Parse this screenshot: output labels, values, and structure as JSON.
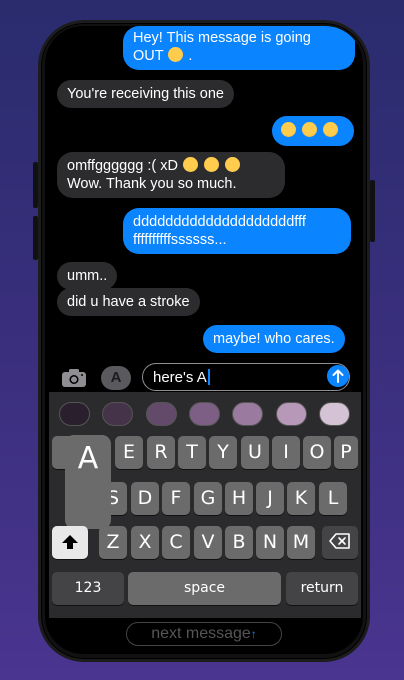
{
  "messages": [
    {
      "dir": "out",
      "text": "Hey! This message is going OUT",
      "suffix": "."
    },
    {
      "dir": "in",
      "text": "You're receiving this one"
    },
    {
      "dir": "out",
      "text": ""
    },
    {
      "dir": "in",
      "line1": "omffgggggg :( xD",
      "line2": "Wow. Thank you so much."
    },
    {
      "dir": "out",
      "line1": "ddddddddddddddddddddfff",
      "line2": "ffffffffffssssss..."
    },
    {
      "dir": "in",
      "text": "umm.."
    },
    {
      "dir": "in",
      "text": "did u have a stroke"
    },
    {
      "dir": "out",
      "text": "maybe! who cares."
    }
  ],
  "composer": {
    "value": "here's A",
    "camera_icon": "camera-icon",
    "apps_icon": "app-store-icon",
    "send_icon": "arrow-up-icon"
  },
  "swatches": [
    "#2a1f2d",
    "#45334a",
    "#634a6a",
    "#7d5f85",
    "#9a7a9f",
    "#b898b8",
    "#d4c3d4"
  ],
  "keyboard": {
    "popup": "A",
    "row1": [
      "E",
      "R",
      "T",
      "Y",
      "U",
      "I",
      "O",
      "P"
    ],
    "row2": [
      "S",
      "D",
      "F",
      "G",
      "H",
      "J",
      "K",
      "L"
    ],
    "row3": [
      "Z",
      "X",
      "C",
      "V",
      "B",
      "N",
      "M"
    ],
    "numbers": "123",
    "space": "space",
    "return": "return"
  },
  "next_button": "next message"
}
